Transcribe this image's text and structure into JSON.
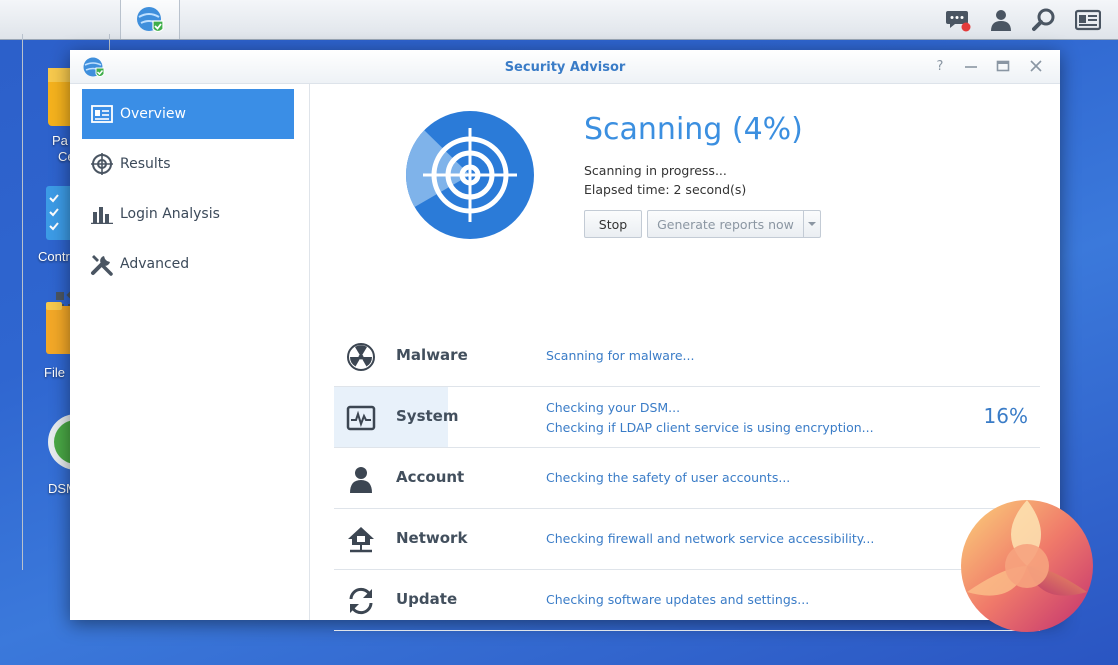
{
  "taskbar": {
    "main_menu_icon": "grid-icon",
    "active_app_icon": "security-advisor-icon",
    "right_icons": [
      "chat-notification-icon",
      "user-icon",
      "search-icon",
      "widgets-icon"
    ]
  },
  "desktop": {
    "labels": [
      "Pa",
      "Ce",
      "Contr",
      "File",
      "DSM"
    ]
  },
  "window": {
    "title": "Security Advisor",
    "controls": {
      "help": "?",
      "minimize": "—",
      "maximize": "▭",
      "close": "✕"
    }
  },
  "sidebar": {
    "items": [
      {
        "label": "Overview",
        "icon": "overview-icon",
        "active": true
      },
      {
        "label": "Results",
        "icon": "target-icon",
        "active": false
      },
      {
        "label": "Login Analysis",
        "icon": "bar-chart-icon",
        "active": false
      },
      {
        "label": "Advanced",
        "icon": "wrench-icon",
        "active": false
      }
    ]
  },
  "scan": {
    "title": "Scanning (4%)",
    "progress_percent": 4,
    "status": "Scanning in progress...",
    "elapsed": "Elapsed time: 2 second(s)",
    "stop_label": "Stop",
    "reports_label": "Generate reports now"
  },
  "categories": [
    {
      "name": "Malware",
      "icon": "radiation-icon",
      "lines": [
        "Scanning for malware..."
      ],
      "percent": ""
    },
    {
      "name": "System",
      "icon": "system-monitor-icon",
      "lines": [
        "Checking your DSM...",
        "Checking if LDAP client service is using encryption..."
      ],
      "percent": "16%"
    },
    {
      "name": "Account",
      "icon": "account-icon",
      "lines": [
        "Checking the safety of user accounts..."
      ],
      "percent": ""
    },
    {
      "name": "Network",
      "icon": "network-icon",
      "lines": [
        "Checking firewall and network service accessibility..."
      ],
      "percent": ""
    },
    {
      "name": "Update",
      "icon": "update-icon",
      "lines": [
        "Checking software updates and settings..."
      ],
      "percent": ""
    }
  ],
  "colors": {
    "accent": "#3a8ee6",
    "link_text": "#3a7cc7",
    "desktop_bg": "#2f66d0"
  }
}
